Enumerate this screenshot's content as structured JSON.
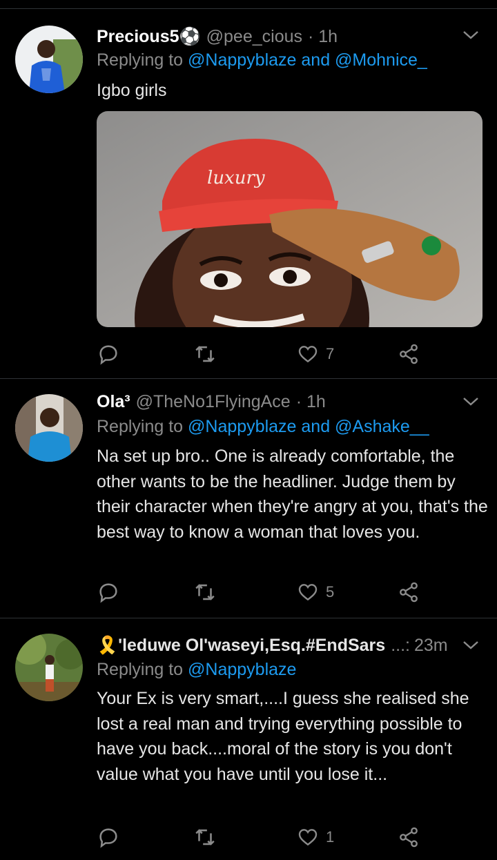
{
  "tweets": [
    {
      "name": "Precious5⚽",
      "handle": "@pee_cious",
      "time": "· 1h",
      "replying_prefix": "Replying to",
      "replying_links": "@Nappyblaze and @Mohnice_",
      "body": "Igbo girls",
      "media_text": "luxury",
      "likes": "7"
    },
    {
      "name": "Ola³",
      "handle": "@TheNo1FlyingAce",
      "time": "· 1h",
      "replying_prefix": "Replying to",
      "replying_links": "@Nappyblaze and @Ashake__",
      "body": "Na set up bro.. One is already comfortable, the other wants to be the headliner. Judge them by their character when they're angry at you, that's the best way to know a woman that loves you.",
      "likes": "5"
    },
    {
      "name": "🎗️'leduwe Ol'waseyi,Esq.#EndSars",
      "handle": "...:",
      "time": "23m",
      "replying_prefix": "Replying to",
      "replying_links": "@Nappyblaze",
      "body": "Your Ex is very smart,....I guess she realised she lost a real man and trying everything possible to have you back....moral of the story is you don't value what you have until you lose it...",
      "likes": "1"
    }
  ],
  "icons": {
    "reply": "reply-icon",
    "retweet": "retweet-icon",
    "like": "heart-icon",
    "share": "share-icon",
    "menu": "chevron-down-icon"
  },
  "colors": {
    "background": "#000000",
    "link": "#1d9bf0",
    "muted": "#8b8b8b",
    "text": "#e6e6e6"
  }
}
